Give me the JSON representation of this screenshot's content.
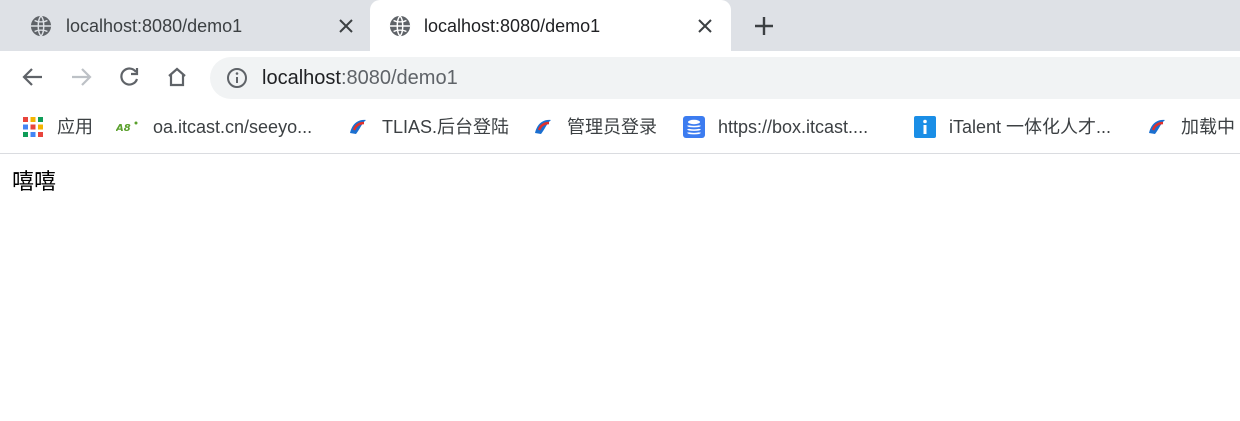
{
  "tabs": [
    {
      "title": "localhost:8080/demo1",
      "active": false
    },
    {
      "title": "localhost:8080/demo1",
      "active": true
    }
  ],
  "toolbar": {
    "url_host": "localhost",
    "url_rest": ":8080/demo1"
  },
  "bookmarks": [
    {
      "label": "应用",
      "icon": "apps-grid-icon"
    },
    {
      "label": "oa.itcast.cn/seeyo...",
      "icon": "seeyon-logo-icon"
    },
    {
      "label": "TLIAS.后台登陆",
      "icon": "tlias-logo-icon"
    },
    {
      "label": "管理员登录",
      "icon": "tlias-logo-icon"
    },
    {
      "label": "https://box.itcast....",
      "icon": "database-icon"
    },
    {
      "label": "iTalent 一体化人才...",
      "icon": "info-tile-icon"
    },
    {
      "label": "加载中",
      "icon": "tlias-logo-icon"
    }
  ],
  "page": {
    "text": "嘻嘻"
  },
  "colors": {
    "tabstrip_bg": "#dee1e6",
    "omnibox_bg": "#f1f3f4",
    "icon_gray": "#5f6368",
    "icon_disabled": "#bdc1c6",
    "tlias_blue": "#1a6fd0",
    "tlias_red": "#e0312c",
    "db_blue": "#3c7cf0",
    "italent_blue": "#1a8ee6"
  }
}
